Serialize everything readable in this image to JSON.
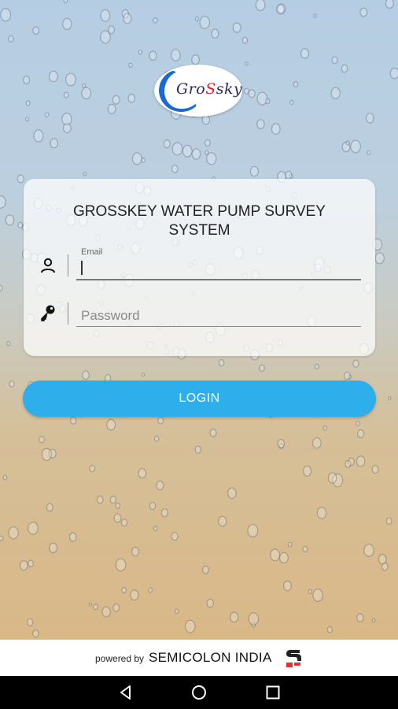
{
  "logo": {
    "text_part1": "Gro",
    "text_accent": "S",
    "text_part2": "sky"
  },
  "login_card": {
    "title": "GROSSKEY WATER PUMP SURVEY SYSTEM",
    "email": {
      "label": "Email",
      "value": "",
      "icon": "person-icon"
    },
    "password": {
      "placeholder": "Password",
      "value": "",
      "icon": "key-icon"
    }
  },
  "login_button": {
    "label": "LOGIN"
  },
  "footer": {
    "powered_by": "powered by",
    "brand": "SEMICOLON INDIA"
  },
  "navigation": {
    "back": "back-icon",
    "home": "home-icon",
    "recents": "recents-icon"
  },
  "colors": {
    "button": "#2eaeea",
    "logo_blue": "#1a6ad1",
    "logo_red": "#d9232d",
    "brand_red": "#e3332c"
  }
}
